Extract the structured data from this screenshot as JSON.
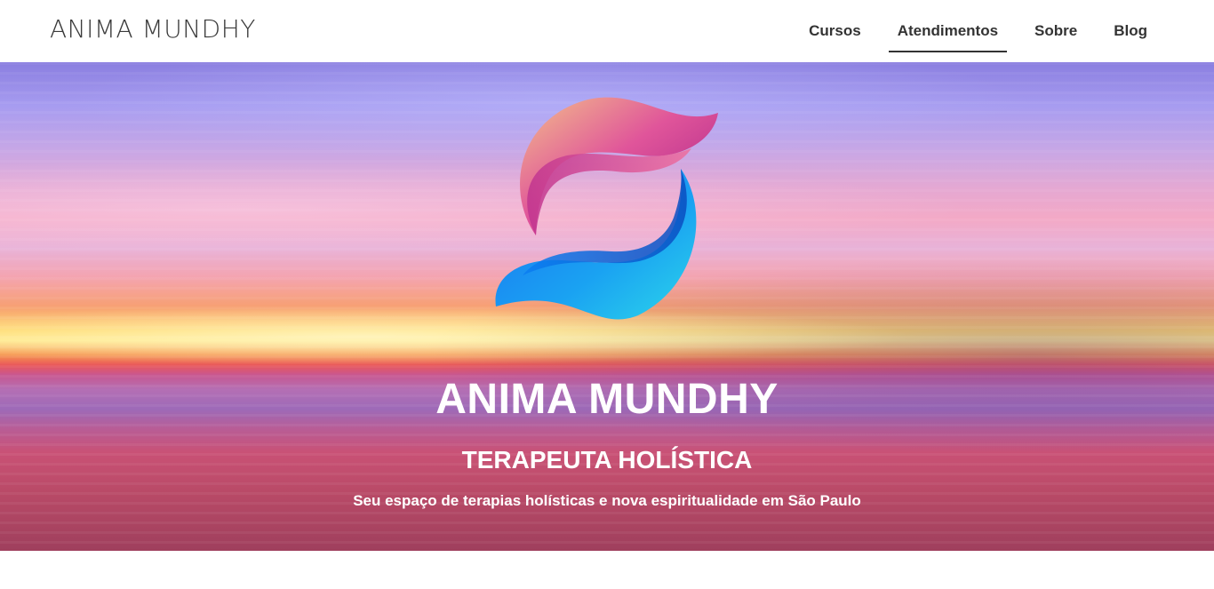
{
  "header": {
    "brand": "ANIMA MUNDHY",
    "nav": [
      {
        "label": "Cursos",
        "active": false
      },
      {
        "label": "Atendimentos",
        "active": true
      },
      {
        "label": "Sobre",
        "active": false
      },
      {
        "label": "Blog",
        "active": false
      }
    ]
  },
  "hero": {
    "title": "ANIMA MUNDHY",
    "subtitle": "TERAPEUTA HOLÍSTICA",
    "tagline": "Seu espaço de terapias holísticas e nova espiritualidade em São Paulo",
    "logo_icon": "wave-s-logo-icon"
  },
  "colors": {
    "text_dark": "#333333",
    "logo_top": "#e07ab0",
    "logo_bottom": "#1e8ff0"
  }
}
